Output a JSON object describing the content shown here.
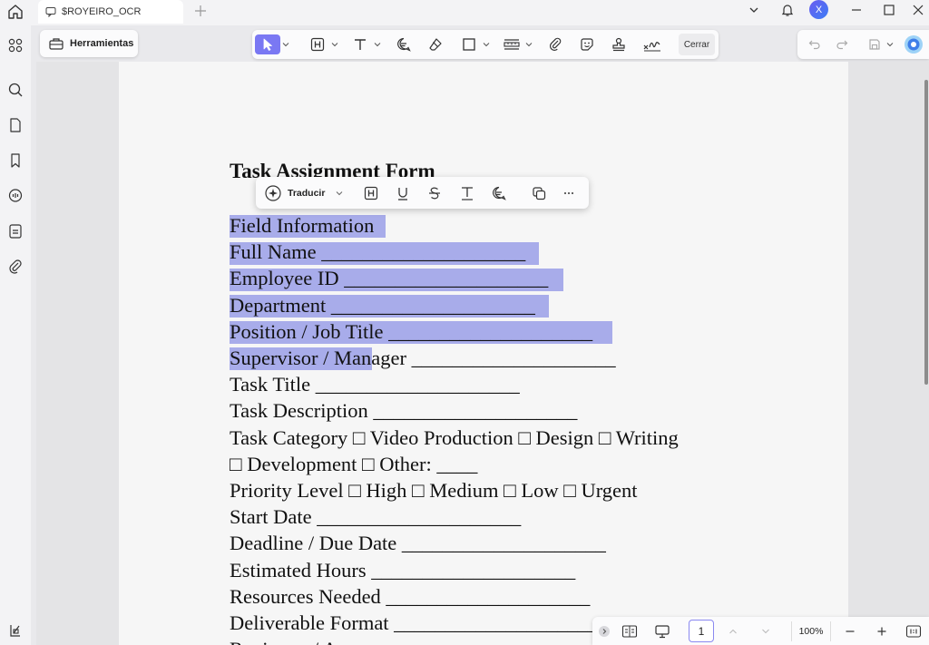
{
  "tab": {
    "title": "$ROYEIRO_OCR"
  },
  "user": {
    "initial": "X"
  },
  "toolbar": {
    "tools_label": "Herramientas",
    "close_label": "Cerrar"
  },
  "selection_toolbar": {
    "translate_label": "Traducir"
  },
  "document": {
    "title": "Task Assignment Form",
    "lines": [
      "Field Information",
      "Full Name ____________________",
      "Employee ID ____________________",
      "Department ____________________",
      "Position / Job Title ____________________",
      "Supervisor / Manager ____________________",
      "Task Title ____________________",
      "Task Description ____________________",
      "Task Category □ Video Production □ Design □ Writing",
      "□ Development □ Other: ____",
      "Priority Level □ High □ Medium □ Low □ Urgent",
      "Start Date ____________________",
      "Deadline / Due Date ____________________",
      "Estimated Hours ____________________",
      "Resources Needed ____________________",
      "Deliverable Format ____________________",
      "Reviewer / Approver"
    ]
  },
  "navigation": {
    "current_page": "1",
    "zoom": "100%"
  },
  "colors": {
    "accent": "#7a78f3",
    "selection_highlight": "#a8acea"
  }
}
